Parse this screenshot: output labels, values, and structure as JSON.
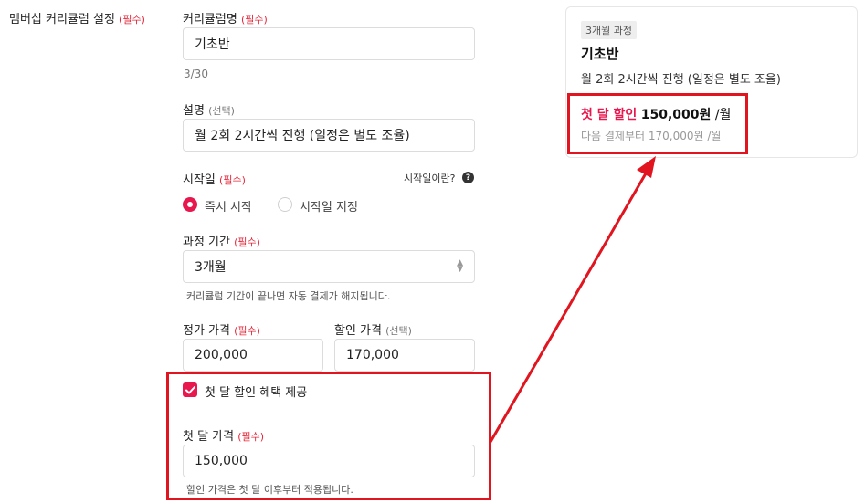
{
  "section": {
    "label": "멤버십 커리큘럼 설정",
    "required": "(필수)"
  },
  "name_field": {
    "label": "커리큘럼명",
    "required": "(필수)",
    "value": "기초반",
    "counter": "3/30"
  },
  "desc_field": {
    "label": "설명",
    "optional": "(선택)",
    "value": "월 2회 2시간씩 진행 (일정은 별도 조율)"
  },
  "start_field": {
    "label": "시작일",
    "required": "(필수)",
    "help_link": "시작일이란?",
    "options": [
      {
        "label": "즉시 시작",
        "selected": true
      },
      {
        "label": "시작일 지정",
        "selected": false
      }
    ]
  },
  "period_field": {
    "label": "과정 기간",
    "required": "(필수)",
    "value": "3개월",
    "help": "커리큘럼 기간이 끝나면 자동 결제가 해지됩니다."
  },
  "price_field": {
    "label": "정가 가격",
    "required": "(필수)",
    "value": "200,000"
  },
  "discount_field": {
    "label": "할인 가격",
    "optional": "(선택)",
    "value": "170,000"
  },
  "first_month": {
    "checkbox_label": "첫 달 할인 혜택 제공",
    "checked": true,
    "label": "첫 달 가격",
    "required": "(필수)",
    "value": "150,000",
    "help": "할인 가격은 첫 달 이후부터 적용됩니다."
  },
  "preview": {
    "tag": "3개월 과정",
    "title": "기초반",
    "desc": "월 2회 2시간씩 진행 (일정은 별도 조율)",
    "first_label": "첫 달 할인",
    "first_price": "150,000원",
    "per_month": "/월",
    "next_text": "다음 결제부터 170,000원 /월"
  },
  "colors": {
    "accent": "#e8174e",
    "annotation_red": "#e0151f"
  }
}
